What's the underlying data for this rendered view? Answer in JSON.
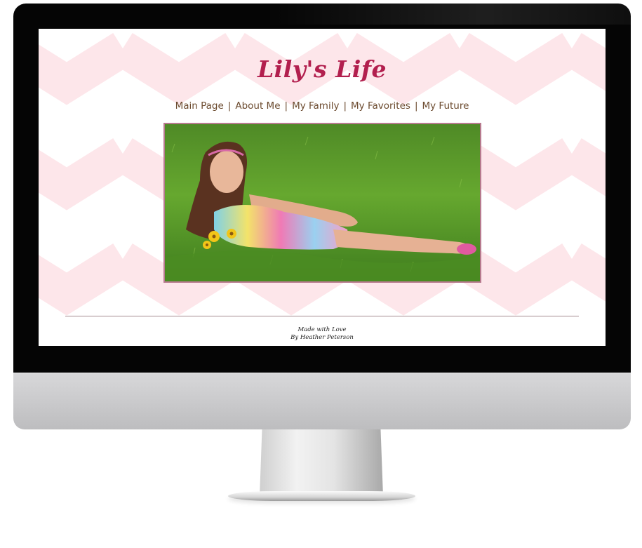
{
  "site": {
    "title": "Lily's Life",
    "nav": [
      {
        "label": "Main Page"
      },
      {
        "label": "About Me"
      },
      {
        "label": "My Family"
      },
      {
        "label": "My Favorites"
      },
      {
        "label": "My Future"
      }
    ],
    "nav_separator": "|",
    "footer": {
      "line1": "Made with Love",
      "line2": "By Heather Peterson"
    }
  },
  "hero_image": {
    "subject": "girl-lying-in-grass-photo"
  },
  "colors": {
    "chevron_pink": "#fde6ea",
    "title": "#b21f4e",
    "nav": "#6b4a2e",
    "photo_border": "#b77a8e",
    "bezel": "#050505",
    "chin": "#c9c9cb"
  }
}
